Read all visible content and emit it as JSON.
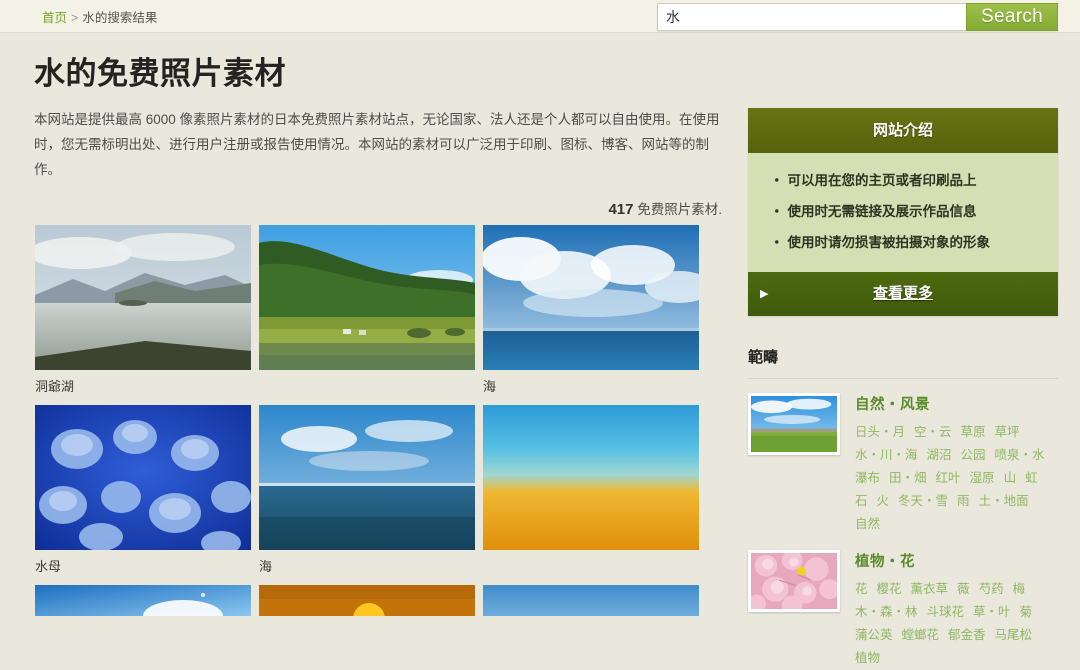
{
  "header": {
    "breadcrumb": {
      "home": "首页",
      "separator": ">",
      "current": "水的搜索结果"
    },
    "search": {
      "value": "水",
      "placeholder": "",
      "button_label": "Search",
      "button_color": "#8cb33c"
    }
  },
  "main": {
    "title": "水的免费照片素材",
    "description": "本网站是提供最高 6000 像素照片素材的日本免费照片素材站点，无论国家、法人还是个人都可以自由使用。在使用时，您无需标明出处、进行用户注册或报告使用情况。本网站的素材可以广泛用于印刷、图标、博客、网站等的制作。",
    "count_number": "417",
    "count_suffix": "免费照片素材."
  },
  "gallery": {
    "rows": [
      [
        {
          "caption": "洞爺湖",
          "alt": "lake-with-mountains"
        },
        {
          "caption": "",
          "alt": "green-forest-and-marsh"
        },
        {
          "caption": "海",
          "alt": "sea-with-clouds"
        }
      ],
      [
        {
          "caption": "水母",
          "alt": "jellyfish"
        },
        {
          "caption": "海",
          "alt": "calm-blue-sea"
        },
        {
          "caption": "",
          "alt": "orange-sunset-sky"
        }
      ],
      [
        {
          "caption": "",
          "alt": "sun-flare-blue-sky"
        },
        {
          "caption": "",
          "alt": "orange-sunset-sun"
        },
        {
          "caption": "",
          "alt": "blue-sky-gradient"
        }
      ]
    ]
  },
  "sidebar": {
    "panel": {
      "title": "网站介绍",
      "items": [
        "可以用在您的主页或者印刷品上",
        "使用时无需链接及展示作品信息",
        "使用时请勿损害被拍摄对象的形象"
      ],
      "bullet": "・",
      "more_label": "查看更多",
      "more_arrow": "▶",
      "head_color": "#5e6b10",
      "body_color": "#d6dfb3",
      "foot_color": "#47640d"
    },
    "categories_heading": "範疇",
    "categories": [
      {
        "title": "自然・风景",
        "thumb_alt": "grass-field-and-blue-sky",
        "tags": [
          "日头・月",
          "空・云",
          "草原",
          "草坪",
          "水・川・海",
          "湖沼",
          "公园",
          "喷泉・水",
          "瀑布",
          "田・畑",
          "红叶",
          "湿原",
          "山",
          "虹",
          "石",
          "火",
          "冬天・雪",
          "雨",
          "土・地面",
          "自然"
        ]
      },
      {
        "title": "植物・花",
        "thumb_alt": "pink-cherry-blossoms",
        "tags": [
          "花",
          "樱花",
          "薰衣草",
          "薇",
          "芍药",
          "梅",
          "木・森・林",
          "斗球花",
          "草・叶",
          "菊",
          "蒲公英",
          "螳螂花",
          "郁金香",
          "马尾松",
          "植物"
        ]
      }
    ],
    "link_color": "#5a8c2b",
    "tag_color": "#8fb862"
  }
}
